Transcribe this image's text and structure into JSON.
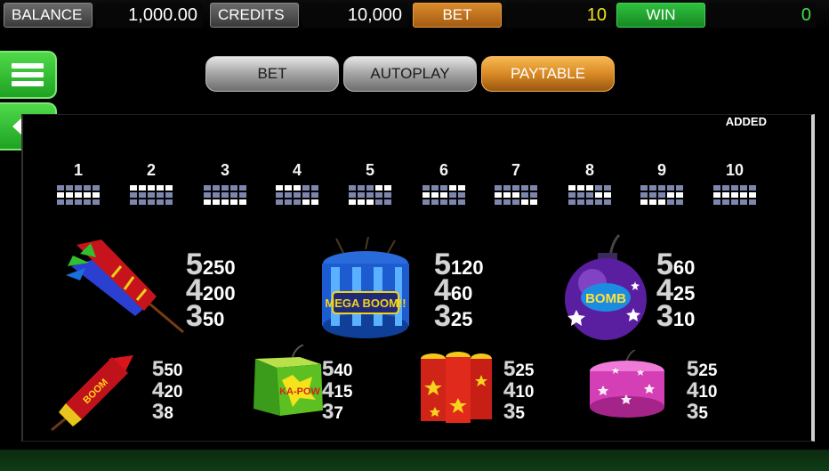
{
  "topbar": {
    "balance_label": "BALANCE",
    "balance_value": "1,000.00",
    "credits_label": "CREDITS",
    "credits_value": "10,000",
    "bet_label": "BET",
    "bet_value": "10",
    "win_label": "WIN",
    "win_value": "0"
  },
  "tabs": [
    {
      "label": "BET"
    },
    {
      "label": "AUTOPLAY"
    },
    {
      "label": "PAYTABLE"
    }
  ],
  "paytable": {
    "added": "ADDED",
    "lines": [
      {
        "num": "1"
      },
      {
        "num": "2"
      },
      {
        "num": "3"
      },
      {
        "num": "4"
      },
      {
        "num": "5"
      },
      {
        "num": "6"
      },
      {
        "num": "7"
      },
      {
        "num": "8"
      },
      {
        "num": "9"
      },
      {
        "num": "10"
      }
    ],
    "symbols": [
      {
        "name": "Rockets",
        "pays": [
          {
            "count": "5",
            "amount": "250"
          },
          {
            "count": "4",
            "amount": "200"
          },
          {
            "count": "3",
            "amount": "50"
          }
        ]
      },
      {
        "name": "Mega Boom",
        "logo_text": "MEGA BOOM!!",
        "pays": [
          {
            "count": "5",
            "amount": "120"
          },
          {
            "count": "4",
            "amount": "60"
          },
          {
            "count": "3",
            "amount": "25"
          }
        ]
      },
      {
        "name": "Bomb",
        "logo_text": "BOMB",
        "pays": [
          {
            "count": "5",
            "amount": "60"
          },
          {
            "count": "4",
            "amount": "25"
          },
          {
            "count": "3",
            "amount": "10"
          }
        ]
      },
      {
        "name": "Boom Rocket",
        "logo_text": "BOOM",
        "pays": [
          {
            "count": "5",
            "amount": "50"
          },
          {
            "count": "4",
            "amount": "20"
          },
          {
            "count": "3",
            "amount": "8"
          }
        ]
      },
      {
        "name": "Kapow Box",
        "logo_text": "KA-POW",
        "pays": [
          {
            "count": "5",
            "amount": "40"
          },
          {
            "count": "4",
            "amount": "15"
          },
          {
            "count": "3",
            "amount": "7"
          }
        ]
      },
      {
        "name": "Firecrackers",
        "pays": [
          {
            "count": "5",
            "amount": "25"
          },
          {
            "count": "4",
            "amount": "10"
          },
          {
            "count": "3",
            "amount": "5"
          }
        ]
      },
      {
        "name": "Pink Cake",
        "pays": [
          {
            "count": "5",
            "amount": "25"
          },
          {
            "count": "4",
            "amount": "10"
          },
          {
            "count": "3",
            "amount": "5"
          }
        ]
      }
    ]
  },
  "colors": {
    "bet_orange": "#d98a2a",
    "win_green": "#2fbf3f",
    "bet_value_yellow": "#f1e11c",
    "win_value_green": "#3fe04a",
    "side_button_green": "#3cc83a",
    "active_tab_orange": "#e0902c"
  },
  "icons": {
    "menu": "hamburger-menu-icon",
    "back": "arrow-left-icon"
  }
}
